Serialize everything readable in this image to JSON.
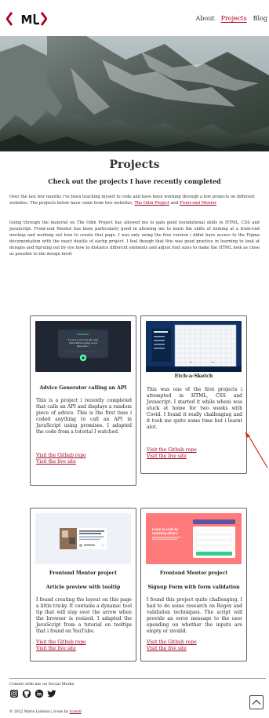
{
  "header": {
    "logo_text": "<ML>",
    "nav": [
      {
        "label": "About",
        "active": false
      },
      {
        "label": "Projects",
        "active": true
      },
      {
        "label": "Blog",
        "active": false
      }
    ]
  },
  "main": {
    "title": "Projects",
    "subtitle": "Check out the projects I have recently completed",
    "intro": {
      "text_before": "Over the last few months i've been teaching myself to code and have been working through a few projects on different websites. The projects below have come from two websites, ",
      "link1": "The Odin Project",
      "text_middle": " and ",
      "link2": "Front-end Mentor",
      "paragraph2": "Going through the material on The Odin Project has allowed me to gain good foundational skills in HTML, CSS and JavaScript. Front-end Mentor has been particularly good in allowing me to learn the skills of looking at a front-end mockup and working out how to create that page. I was only using the free version i didnt have access to the Figma documentation with the exact deatils of eachg project. I feel though that this was good practice in learning to look at deisgns and figruing out by eye how to distance different elements and adjust font sizes to make the HTML look as close as possible to the deisgn breif."
    }
  },
  "projects": [
    {
      "provider": "Frontend Mentor project",
      "title": "Advice Generator calling an API",
      "description": "This is a project i recently completed that calls an API and displays a random piece of advice. This is the first time i coded anything to call an API in JavaScript using promises. I adapted the code from a totorial I watched.",
      "repo_link": "Visit the Github repo",
      "live_link": "Visit the live site"
    },
    {
      "provider": "The Odin Project Assignment",
      "title": "Etch-a-Sketch",
      "description": "This was one of the first projects i attempted in HTML, CSS and Javascript. I started it while wheni was stuck at home for two weeks with Covid. I found it really challenging and it took me quite some time but i learnt alot.",
      "repo_link": "Visit the Github repo",
      "live_link": "Visit the live site"
    },
    {
      "provider": "Frontend Mentor project",
      "title": "Article preview with tooltip",
      "description": "I found creating the layout on this page a little tricky. It contains a dynamic tool tip that will stay over the arrow when the browser is resized. I adapted the JavaScript from a tutorial on tooltips that i found on YouTube.",
      "repo_link": "Visit the Github repo",
      "live_link": "Visit the live site"
    },
    {
      "provider": "Frontend Mentor project",
      "title": "Signup Form with form validation",
      "description": "I found this project quite challenging. I had to do some research on Regex and validation techniques. The script will provide an error message to the user epending on whether the inputs are empty or invalid.",
      "repo_link": "Visit the Github repo",
      "live_link": "Visit the live site"
    }
  ],
  "footer": {
    "connect": "Connet with me on Social Media",
    "copyright_text": "© 2022 Mario Lisbona | Icons by ",
    "icons_link": "Icons8",
    "social_icons": [
      "instagram-icon",
      "github-icon",
      "linkedin-icon",
      "twitter-icon"
    ]
  },
  "thumbnails": {
    "advice_card": {
      "label": "ADVICE #117",
      "quote": "“It is easy to sit up and take notice, what's difficult is getting up and taking action.”"
    },
    "article_card": {
      "title": "Shift the overall look and feel by adding these wonderful touches to furniture in your home",
      "author": "Michelle Appleton"
    },
    "signup_card": {
      "headline": "Learn to code by watching others",
      "button": "Claim your free trial"
    }
  },
  "colors": {
    "accent": "#a00020",
    "card_border": "#666666",
    "text": "#222222"
  }
}
